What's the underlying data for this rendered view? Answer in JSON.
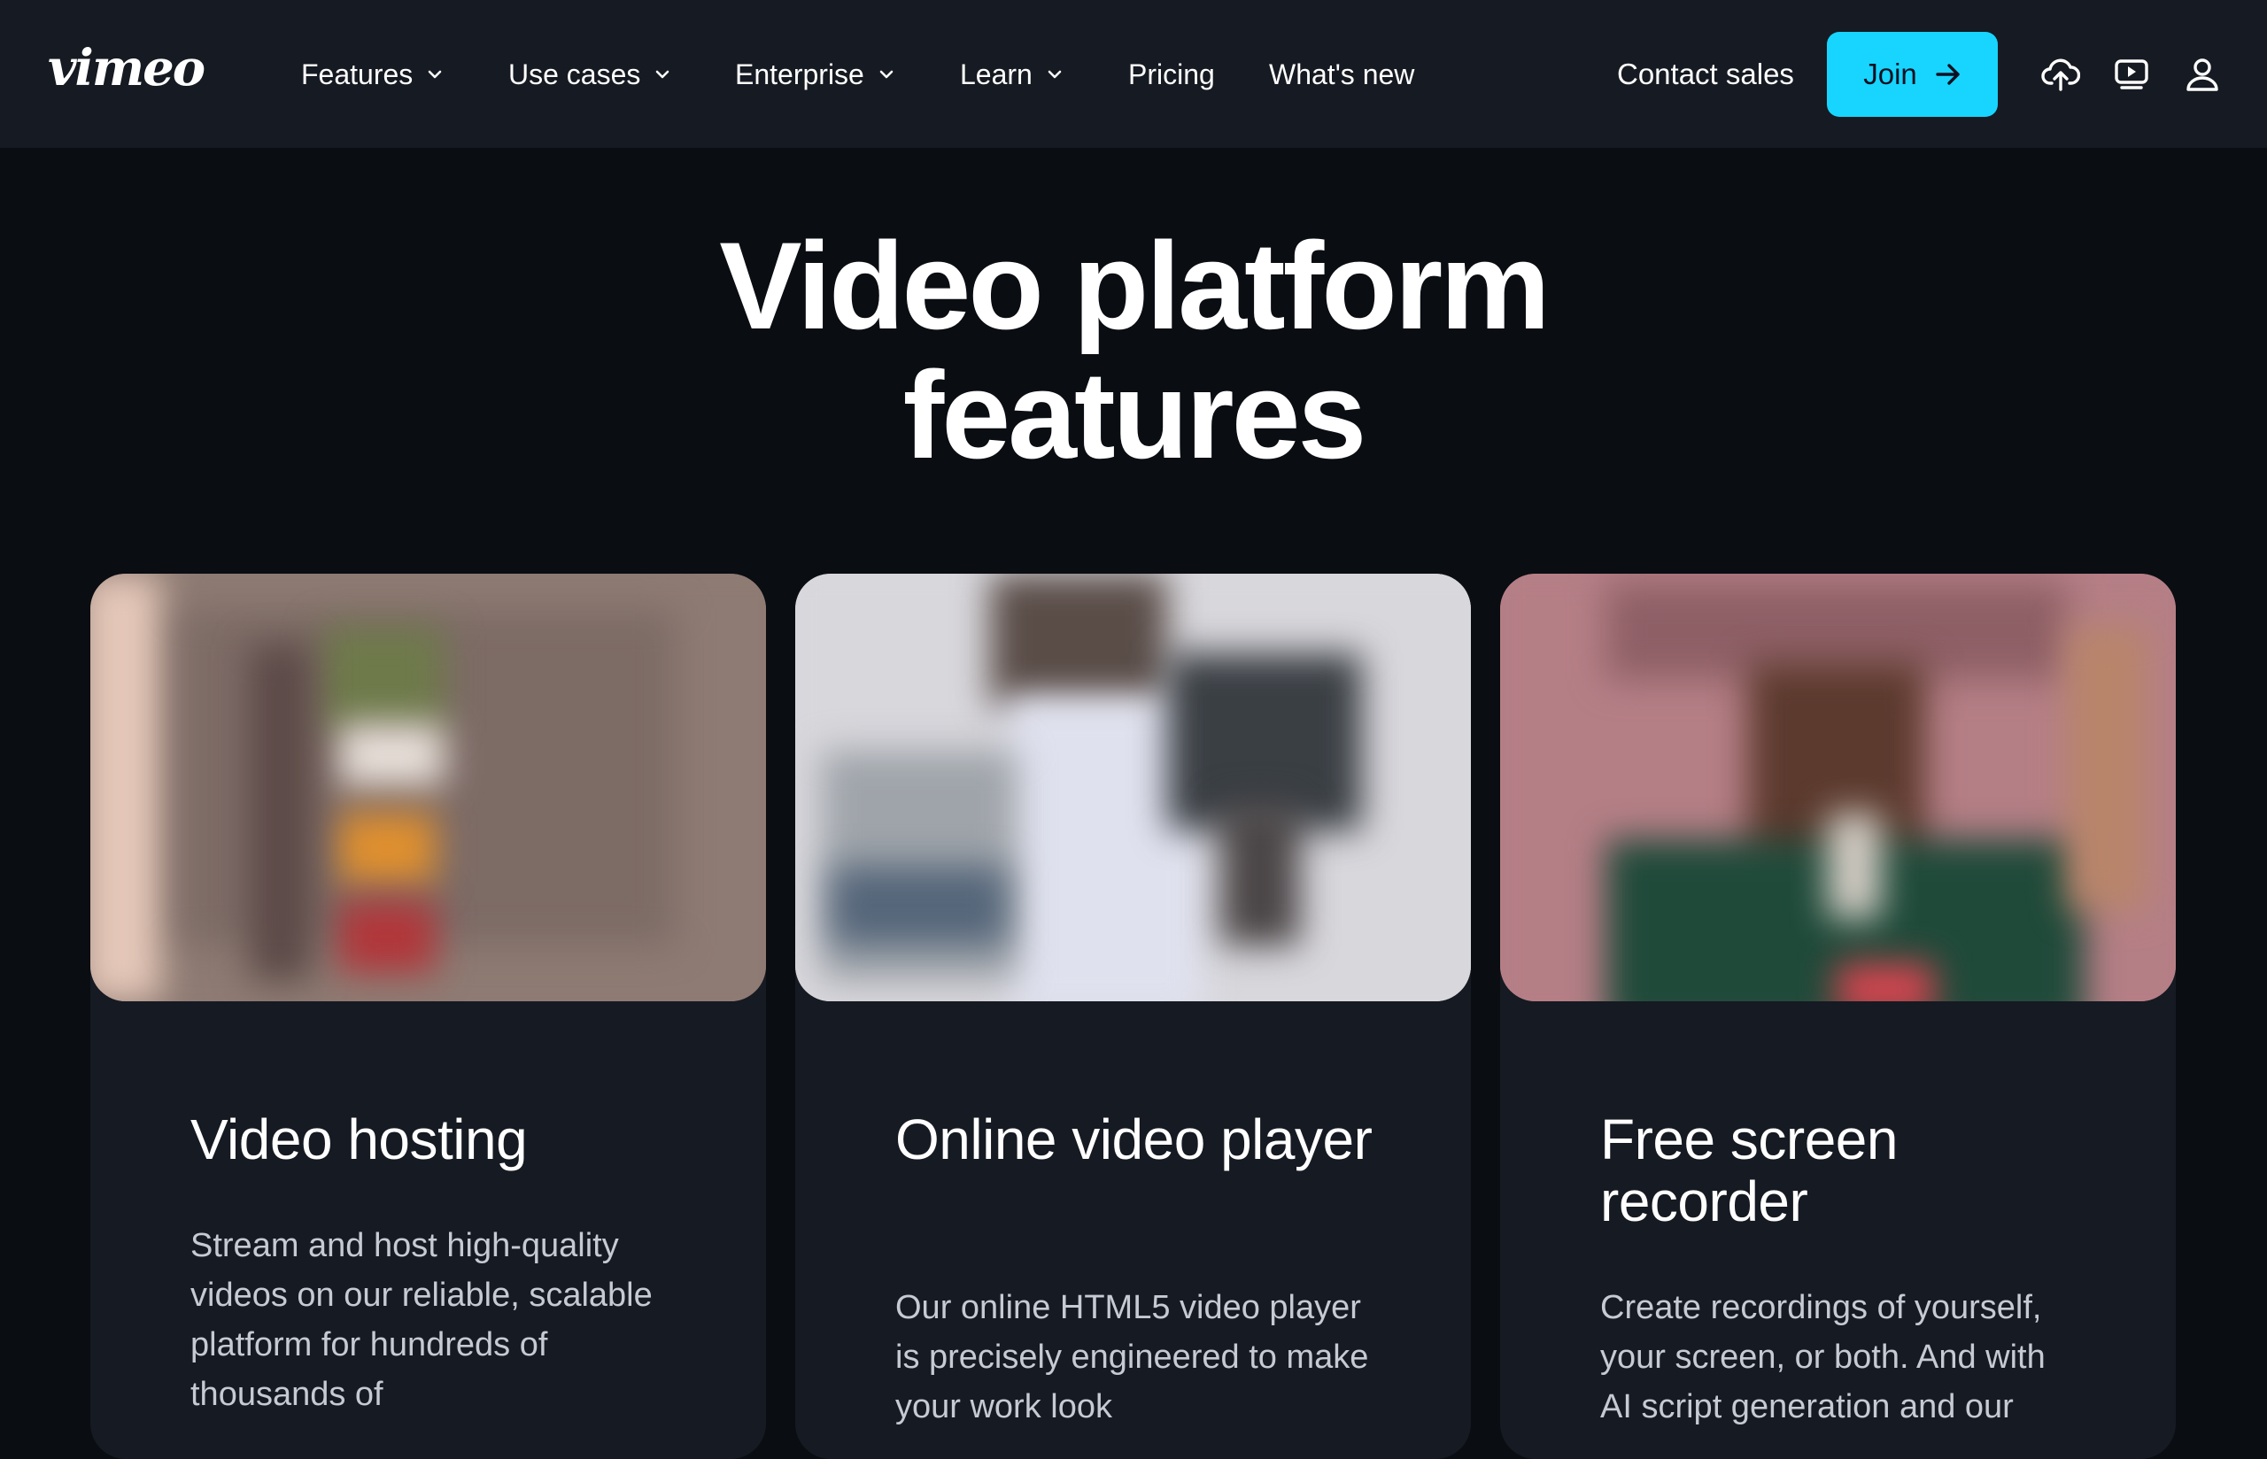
{
  "brand": {
    "logo_text": "vimeo"
  },
  "nav": {
    "items": [
      {
        "label": "Features",
        "dropdown": true
      },
      {
        "label": "Use cases",
        "dropdown": true
      },
      {
        "label": "Enterprise",
        "dropdown": true
      },
      {
        "label": "Learn",
        "dropdown": true
      },
      {
        "label": "Pricing",
        "dropdown": false
      },
      {
        "label": "What's new",
        "dropdown": false
      }
    ],
    "contact_label": "Contact sales",
    "join_label": "Join",
    "icons": [
      "upload-cloud-icon",
      "video-player-icon",
      "user-account-icon"
    ]
  },
  "hero": {
    "title_line1": "Video platform",
    "title_line2": "features"
  },
  "cards": [
    {
      "title": "Video hosting",
      "description": "Stream and host high-quality videos on our reliable, scalable platform for hundreds of thousands of"
    },
    {
      "title": "Online video player",
      "description": "Our online HTML5 video player is precisely engineered to make your work look"
    },
    {
      "title": "Free screen recorder",
      "description": "Create recordings of yourself, your screen, or both. And with AI script generation and our"
    }
  ],
  "colors": {
    "page_background": "#0a0d12",
    "nav_background": "#161a22",
    "card_background": "#161a22",
    "accent": "#17d5ff",
    "body_text": "#c6cad2"
  }
}
